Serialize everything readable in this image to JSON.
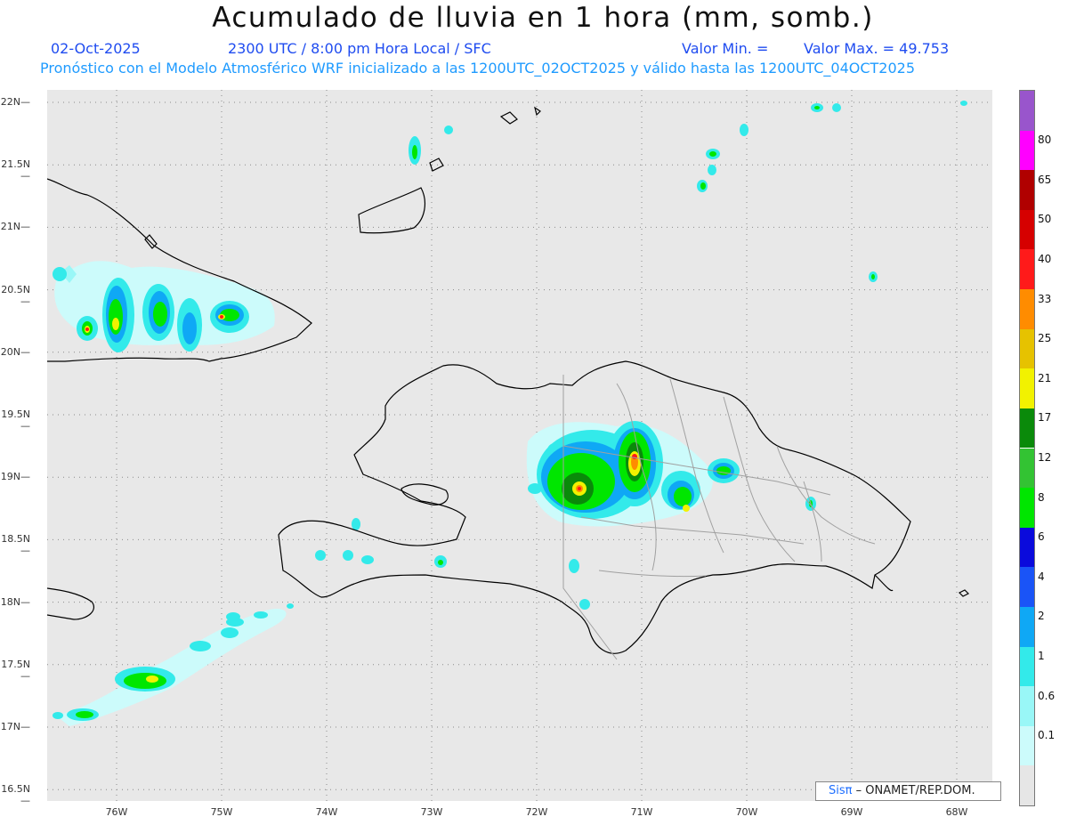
{
  "title": "Acumulado de lluvia en 1 hora (mm, somb.)",
  "date": "02-Oct-2025",
  "time_info": "2300 UTC / 8:00 pm Hora Local / SFC",
  "valor_min": "Valor Min. =",
  "valor_max": "Valor Max. = 49.753",
  "model_info": "Pronóstico con el Modelo Atmosférico WRF inicializado a las 1200UTC_02OCT2025 y válido hasta las  1200UTC_04OCT2025",
  "credit_logo": "Sisπ",
  "credit_text": "– ONAMET/REP.DOM.",
  "lat_labels": [
    "22N",
    "21.5N",
    "21N",
    "20.5N",
    "20N",
    "19.5N",
    "19N",
    "18.5N",
    "18N",
    "17.5N",
    "17N",
    "16.5N"
  ],
  "lon_labels": [
    "76W",
    "75W",
    "74W",
    "73W",
    "72W",
    "71W",
    "70W",
    "69W",
    "68W"
  ],
  "colorbar": {
    "labels": [
      "0.1",
      "0.6",
      "1",
      "2",
      "4",
      "6",
      "8",
      "12",
      "17",
      "21",
      "25",
      "33",
      "40",
      "50",
      "65",
      "80"
    ],
    "colors": [
      "#e6e6e6",
      "#ccfbfb",
      "#99f7f7",
      "#33eaea",
      "#0fa8f5",
      "#1a54f7",
      "#0a0adc",
      "#00e600",
      "#33c333",
      "#0a8a0a",
      "#f2f200",
      "#e6c200",
      "#ff8c00",
      "#ff1a1a",
      "#d60000",
      "#b00000",
      "#ff00ff",
      "#9955cc"
    ]
  },
  "palette": {
    "map_bg": "#e8e8e8",
    "coast": "#000000",
    "borders": "#a0a0a0",
    "grid": "#8a8a8a"
  }
}
